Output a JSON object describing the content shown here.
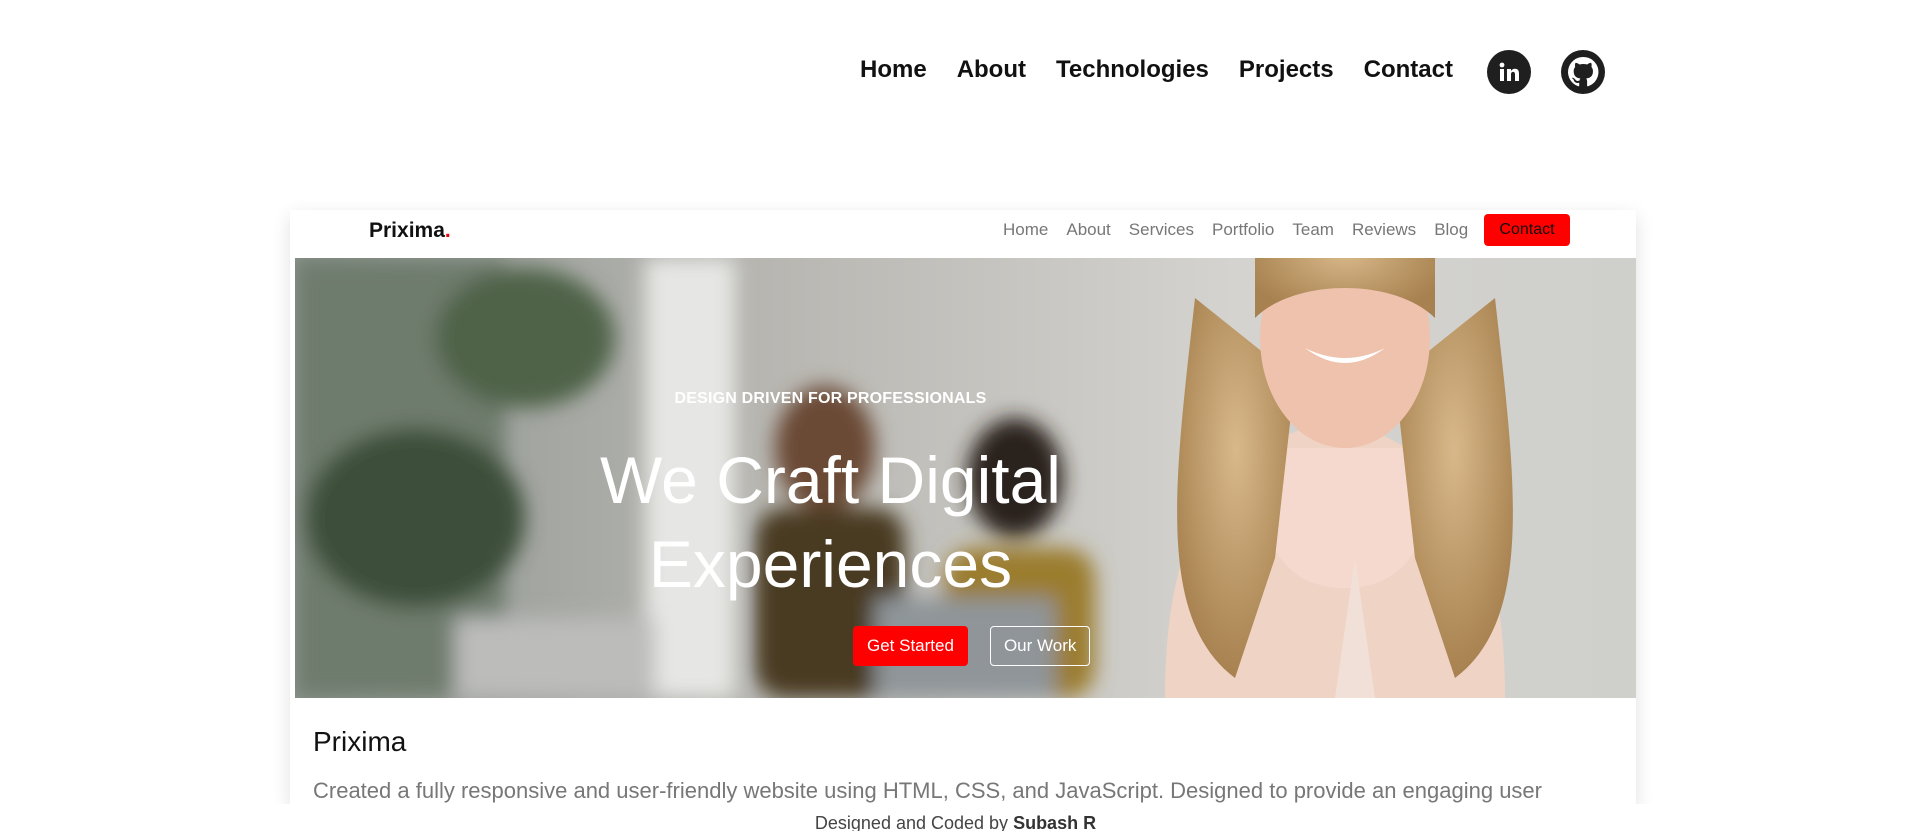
{
  "topnav": {
    "links": [
      "Home",
      "About",
      "Technologies",
      "Projects",
      "Contact"
    ],
    "social": [
      {
        "icon": "linkedin-icon"
      },
      {
        "icon": "github-icon"
      }
    ]
  },
  "project": {
    "preview": {
      "brand": "Prixima",
      "brand_dot": ".",
      "nav_links": [
        "Home",
        "About",
        "Services",
        "Portfolio",
        "Team",
        "Reviews",
        "Blog"
      ],
      "contact_button": "Contact",
      "hero_tagline": "DESIGN DRIVEN FOR PROFESSIONALS",
      "hero_title_line1": "We Craft Digital",
      "hero_title_line2": "Experiences",
      "primary_button": "Get Started",
      "secondary_button": "Our Work"
    },
    "title": "Prixima",
    "description": "Created a fully responsive and user-friendly website using HTML, CSS, and JavaScript. Designed to provide an engaging user"
  },
  "footer": {
    "prefix": "Designed and Coded by",
    "author": "Subash R"
  },
  "colors": {
    "accent": "#ff0000",
    "text": "#111111",
    "muted": "#777777"
  }
}
